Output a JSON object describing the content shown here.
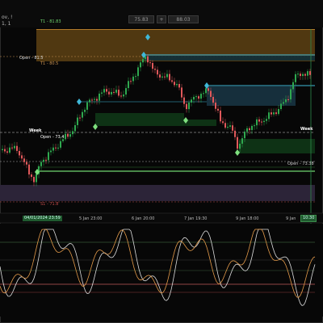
{
  "header": {
    "symbol_line": "ov, !",
    "sub_line": "1, 1",
    "pair_label": "T1 - 81.83",
    "price_field_left": "75.83",
    "toggle_glyph": "+",
    "price_field_right": "88.03"
  },
  "levels": {
    "open_top": "Open - 81.5",
    "t1_mid": "T1 - 80.5",
    "week_left": "Week",
    "week_value": "Open - 73.4",
    "week_right": "Week",
    "open_bottom": "Open - 73.38",
    "pink_level": "S1 - 71.8"
  },
  "time_axis": {
    "first_badge": "04/01/2024 23:59",
    "ticks": [
      "5 Jan 23:00",
      "6 Jan 20:00",
      "7 Jan 19:30",
      "9 Jan 18:00",
      "9 Jan"
    ],
    "last_badge": "10:30"
  },
  "colors": {
    "up": "#2fa84f",
    "down": "#e0585a",
    "cyan": "#3fb8d8",
    "green_line": "#6fd66f",
    "orange_zone": "#6a4a16",
    "purple_zone": "#2c2438",
    "osc_white": "#dddddd",
    "osc_orange": "#e39a4a"
  }
}
